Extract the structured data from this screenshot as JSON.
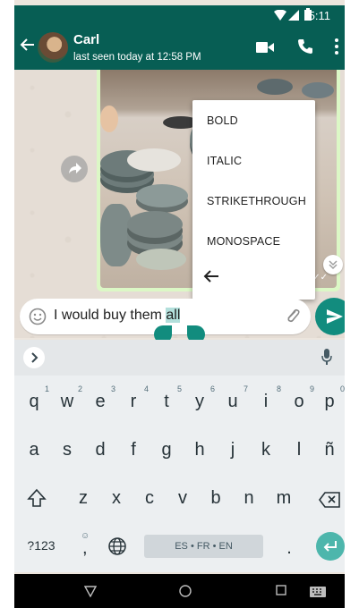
{
  "status_bar": {
    "time": "5:11"
  },
  "header": {
    "contact_name": "Carl",
    "contact_status": "last seen today at 12:58 PM"
  },
  "format_menu": {
    "items": [
      "BOLD",
      "ITALIC",
      "STRIKETHROUGH",
      "MONOSPACE"
    ]
  },
  "compose": {
    "text_before": "I would buy them ",
    "selected_text": "all"
  },
  "keyboard": {
    "row1": [
      {
        "key": "q",
        "hint": "1"
      },
      {
        "key": "w",
        "hint": "2"
      },
      {
        "key": "e",
        "hint": "3"
      },
      {
        "key": "r",
        "hint": "4"
      },
      {
        "key": "t",
        "hint": "5"
      },
      {
        "key": "y",
        "hint": "6"
      },
      {
        "key": "u",
        "hint": "7"
      },
      {
        "key": "i",
        "hint": "8"
      },
      {
        "key": "o",
        "hint": "9"
      },
      {
        "key": "p",
        "hint": "0"
      }
    ],
    "row2": [
      "a",
      "s",
      "d",
      "f",
      "g",
      "h",
      "j",
      "k",
      "l",
      "ñ"
    ],
    "row3": [
      "z",
      "x",
      "c",
      "v",
      "b",
      "n",
      "m"
    ],
    "symbols_key": "?123",
    "comma_key": ",",
    "period_key": ".",
    "space_label": "ES • FR • EN"
  },
  "colors": {
    "primary": "#075e54",
    "accent": "#128c7e",
    "selection": "#b2dfdb",
    "bubble_out": "#dcf8c6"
  },
  "icons": {
    "back": "arrow-left-icon",
    "video": "video-camera-icon",
    "call": "phone-icon",
    "more": "more-vert-icon",
    "emoji": "smiley-icon",
    "attach": "paperclip-icon",
    "send": "send-icon"
  }
}
